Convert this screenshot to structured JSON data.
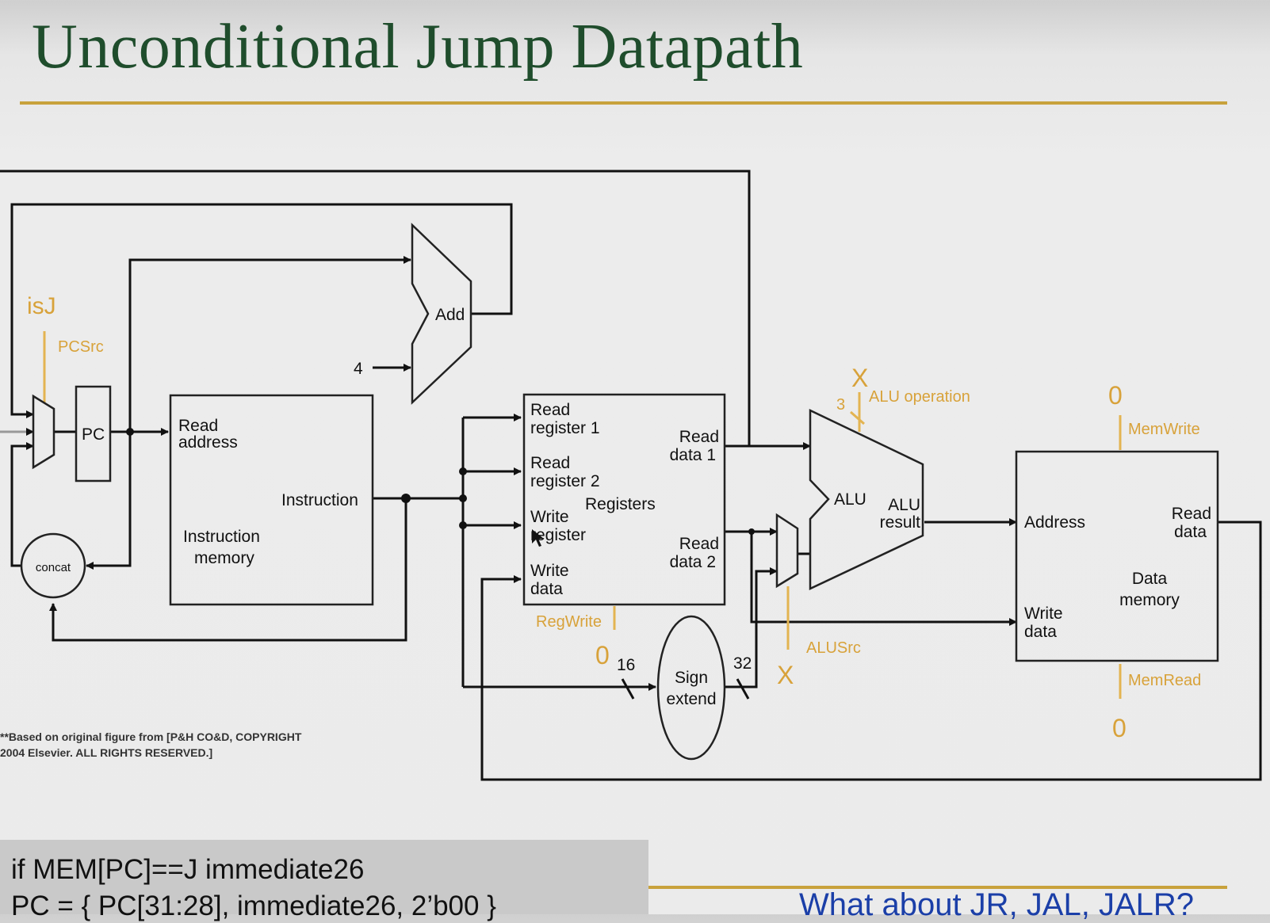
{
  "title": "Unconditional Jump Datapath",
  "labels": {
    "isj": "isJ",
    "pcsrc": "PCSrc",
    "pc": "PC",
    "concat": "concat",
    "add": "Add",
    "four": "4",
    "read_address_1": "Read",
    "read_address_2": "address",
    "instruction": "Instruction",
    "instruction_memory_1": "Instruction",
    "instruction_memory_2": "memory",
    "read_register_1a": "Read",
    "read_register_1b": "register 1",
    "read_register_2a": "Read",
    "read_register_2b": "register 2",
    "write_register_a": "Write",
    "write_register_b": "register",
    "write_data_a": "Write",
    "write_data_b": "data",
    "registers": "Registers",
    "read_data_1a": "Read",
    "read_data_1b": "data 1",
    "read_data_2a": "Read",
    "read_data_2b": "data 2",
    "regwrite": "RegWrite",
    "sign_extend_a": "Sign",
    "sign_extend_b": "extend",
    "width_16": "16",
    "width_32": "32",
    "width_3": "3",
    "alu": "ALU",
    "alu_result_a": "ALU",
    "alu_result_b": "result",
    "alu_operation": "ALU operation",
    "alusrc": "ALUSrc",
    "address": "Address",
    "dm_read_data_a": "Read",
    "dm_read_data_b": "data",
    "dm_write_data_a": "Write",
    "dm_write_data_b": "data",
    "data_memory_a": "Data",
    "data_memory_b": "memory",
    "memwrite": "MemWrite",
    "memread": "MemRead"
  },
  "control_values": {
    "alu_op_x": "X",
    "alusrc_x": "X",
    "regwrite_0": "0",
    "memwrite_0": "0",
    "memread_0": "0"
  },
  "credit": {
    "line1": "**Based on original figure from [P&H CO&D, COPYRIGHT",
    "line2": "2004 Elsevier. ALL RIGHTS RESERVED.]"
  },
  "code": {
    "line1": "if MEM[PC]==J immediate26",
    "line2": "PC = { PC[31:28], immediate26, 2’b00 }"
  },
  "question": "What about JR, JAL, JALR?"
}
